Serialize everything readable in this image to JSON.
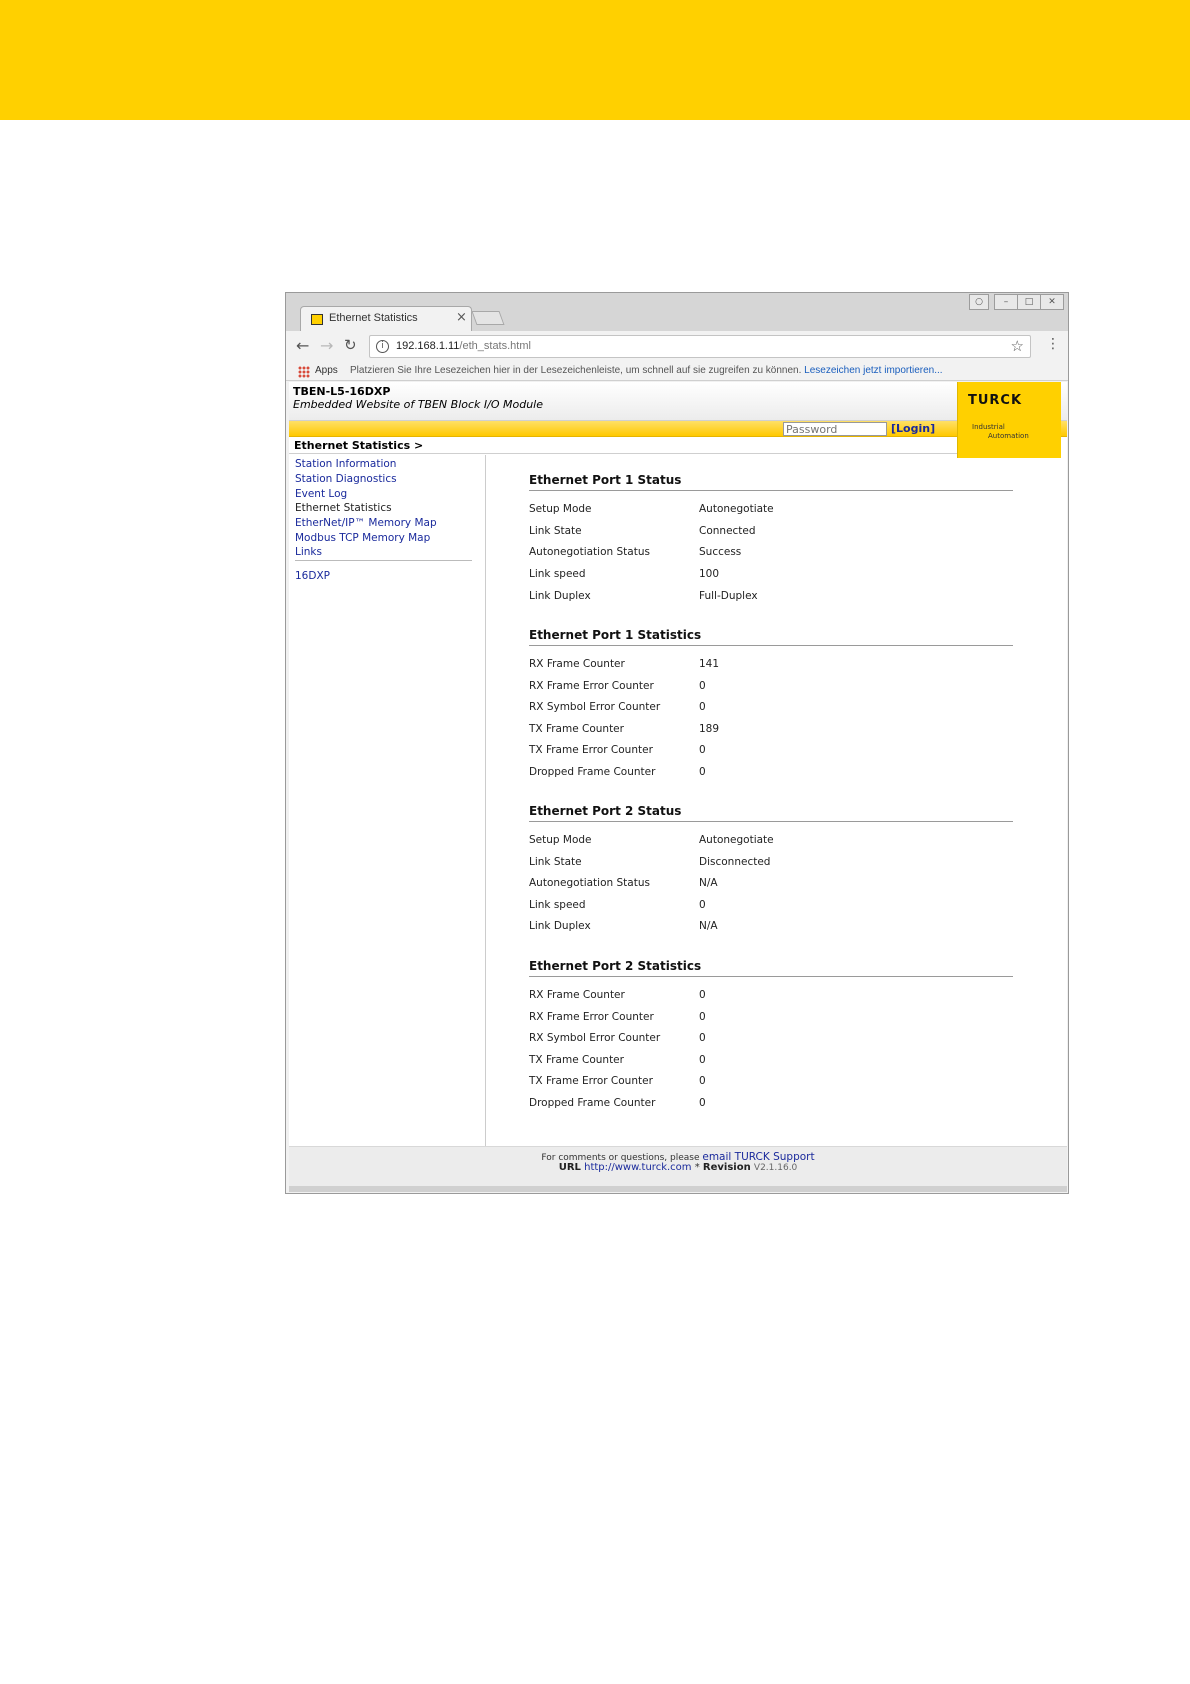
{
  "browser": {
    "tab_title": "Ethernet Statistics",
    "tab_close": "×",
    "url_host": "192.168.1.11",
    "url_path": "/eth_stats.html",
    "apps_label": "Apps",
    "bookmark_hint": "Platzieren Sie Ihre Lesezeichen hier in der Lesezeichenleiste, um schnell auf sie zugreifen zu können.",
    "bookmark_link": "Lesezeichen jetzt importieren..."
  },
  "header": {
    "product": "TBEN-L5-16DXP",
    "subtitle": "Embedded Website of TBEN Block I/O Module",
    "logo_text": "TURCK",
    "logo_tagline_1": "Industrial",
    "logo_tagline_2": "Automation",
    "password_placeholder": "Password",
    "login_label": "[Login]",
    "breadcrumb": "Ethernet Statistics >"
  },
  "sidebar": {
    "items": [
      {
        "label": "Station Information"
      },
      {
        "label": "Station Diagnostics"
      },
      {
        "label": "Event Log"
      },
      {
        "label": "Ethernet Statistics"
      },
      {
        "label": "EtherNet/IP™ Memory Map"
      },
      {
        "label": "Modbus TCP Memory Map"
      },
      {
        "label": "Links"
      }
    ],
    "device": "16DXP"
  },
  "sections": [
    {
      "title": "Ethernet Port 1 Status",
      "rows": [
        {
          "label": "Setup Mode",
          "value": "Autonegotiate"
        },
        {
          "label": "Link State",
          "value": "Connected"
        },
        {
          "label": "Autonegotiation Status",
          "value": "Success"
        },
        {
          "label": "Link speed",
          "value": "100"
        },
        {
          "label": "Link Duplex",
          "value": "Full-Duplex"
        }
      ]
    },
    {
      "title": "Ethernet Port 1 Statistics",
      "rows": [
        {
          "label": "RX Frame Counter",
          "value": "141"
        },
        {
          "label": "RX Frame Error Counter",
          "value": "0"
        },
        {
          "label": "RX Symbol Error Counter",
          "value": "0"
        },
        {
          "label": "TX Frame Counter",
          "value": "189"
        },
        {
          "label": "TX Frame Error Counter",
          "value": "0"
        },
        {
          "label": "Dropped Frame Counter",
          "value": "0"
        }
      ]
    },
    {
      "title": "Ethernet Port 2 Status",
      "rows": [
        {
          "label": "Setup Mode",
          "value": "Autonegotiate"
        },
        {
          "label": "Link State",
          "value": "Disconnected"
        },
        {
          "label": "Autonegotiation Status",
          "value": "N/A"
        },
        {
          "label": "Link speed",
          "value": "0"
        },
        {
          "label": "Link Duplex",
          "value": "N/A"
        }
      ]
    },
    {
      "title": "Ethernet Port 2 Statistics",
      "rows": [
        {
          "label": "RX Frame Counter",
          "value": "0"
        },
        {
          "label": "RX Frame Error Counter",
          "value": "0"
        },
        {
          "label": "RX Symbol Error Counter",
          "value": "0"
        },
        {
          "label": "TX Frame Counter",
          "value": "0"
        },
        {
          "label": "TX Frame Error Counter",
          "value": "0"
        },
        {
          "label": "Dropped Frame Counter",
          "value": "0"
        }
      ]
    }
  ],
  "footer": {
    "comment_text": "For comments or questions, please",
    "support_link": "email TURCK Support",
    "url_label": "URL",
    "url_link": "http://www.turck.com",
    "separator": "*",
    "revision_label": "Revision",
    "revision_value": "V2.1.16.0"
  },
  "colors": {
    "brand_yellow": "#ffd000",
    "link_blue": "#1a2a9c"
  }
}
